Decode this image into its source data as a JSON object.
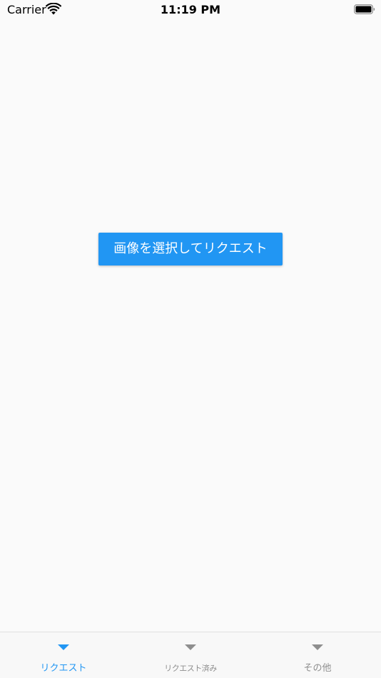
{
  "status_bar": {
    "carrier": "Carrier",
    "time": "11:19 PM",
    "wifi_icon": "wifi-icon",
    "battery_icon": "battery-icon"
  },
  "main": {
    "request_button_label": "画像を選択してリクエスト"
  },
  "tab_bar": {
    "items": [
      {
        "label": "リクエスト",
        "icon": "triangle-down-icon",
        "active": true
      },
      {
        "label": "リクエスト済み",
        "icon": "triangle-down-icon",
        "active": false
      },
      {
        "label": "その他",
        "icon": "triangle-down-icon",
        "active": false
      }
    ]
  },
  "colors": {
    "accent": "#2196f3",
    "background": "#fafafa",
    "inactive": "#8e8e8e"
  }
}
